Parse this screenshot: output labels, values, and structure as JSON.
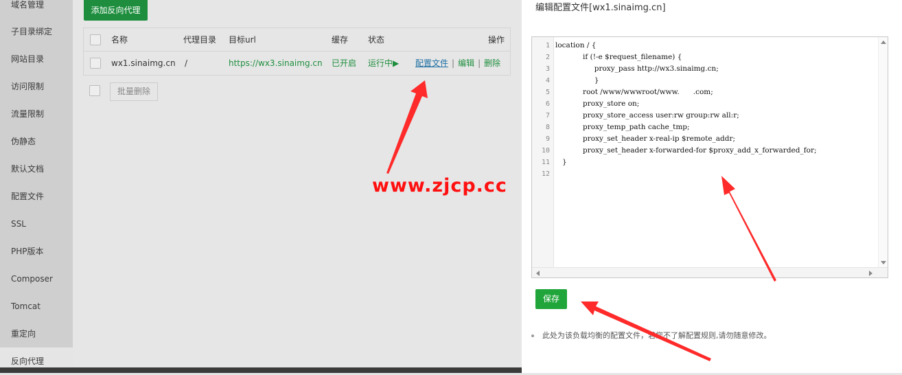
{
  "sidebar": {
    "items": [
      {
        "label": "域名管理"
      },
      {
        "label": "子目录绑定"
      },
      {
        "label": "网站目录"
      },
      {
        "label": "访问限制"
      },
      {
        "label": "流量限制"
      },
      {
        "label": "伪静态"
      },
      {
        "label": "默认文档"
      },
      {
        "label": "配置文件"
      },
      {
        "label": "SSL"
      },
      {
        "label": "PHP版本"
      },
      {
        "label": "Composer"
      },
      {
        "label": "Tomcat"
      },
      {
        "label": "重定向"
      },
      {
        "label": "反向代理"
      }
    ]
  },
  "main": {
    "add_button": "添加反向代理",
    "table": {
      "headers": {
        "name": "名称",
        "dir": "代理目录",
        "url": "目标url",
        "cache": "缓存",
        "status": "状态",
        "actions": "操作"
      },
      "rows": [
        {
          "name": "wx1.sinaimg.cn",
          "dir": "/",
          "url": "https://wx3.sinaimg.cn",
          "cache": "已开启",
          "status": "运行中▶",
          "action_config": "配置文件",
          "action_edit": "编辑",
          "action_delete": "删除",
          "separator": "|"
        }
      ]
    },
    "batch_delete": "批量删除"
  },
  "watermark": "www.zjcp.cc",
  "modal": {
    "title": "编辑配置文件[wx1.sinaimg.cn]",
    "line_numbers": [
      "1",
      "2",
      "3",
      "4",
      "5",
      "6",
      "7",
      "8",
      "9",
      "10",
      "11",
      "12"
    ],
    "code_lines": [
      "location / {",
      "            if (!-e $request_filename) {",
      "                 proxy_pass http://wx3.sinaimg.cn;",
      "                 }",
      "            root /www/wwwroot/www.      .com;",
      "            proxy_store on;",
      "            proxy_store_access user:rw group:rw all:r;",
      "            proxy_temp_path cache_tmp;",
      "            proxy_set_header x-real-ip $remote_addr;",
      "            proxy_set_header x-forwarded-for $proxy_add_x_forwarded_for;",
      "   }",
      ""
    ],
    "save_button": "保存",
    "tip": "此处为该负载均衡的配置文件，若您不了解配置规则,请勿随意修改。"
  },
  "colors": {
    "accent_green": "#20a53a",
    "annotation_red": "#ff2a2a"
  }
}
